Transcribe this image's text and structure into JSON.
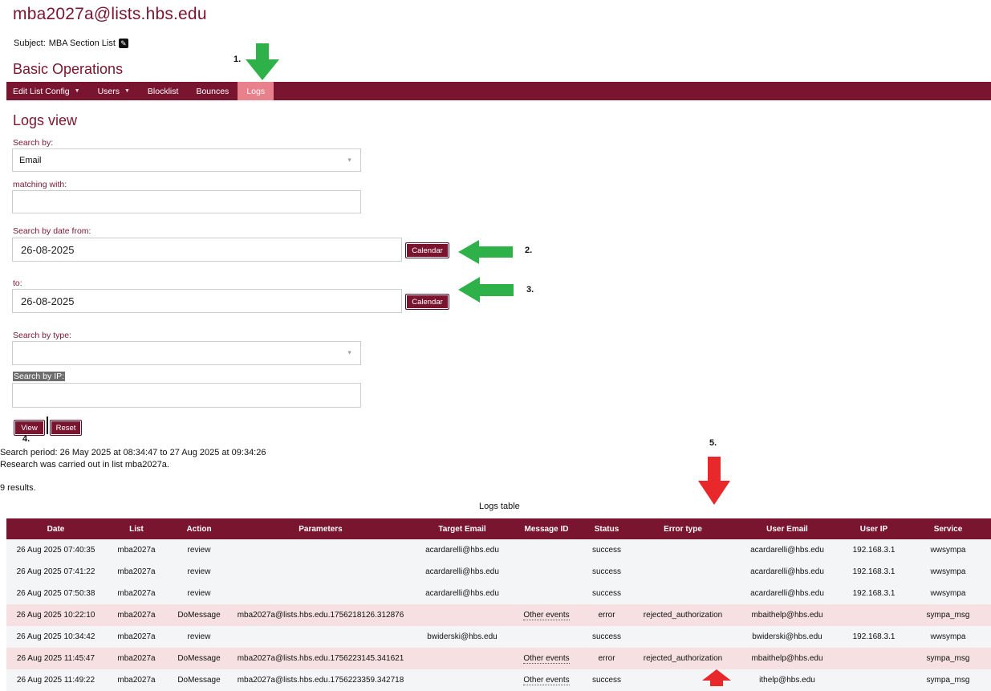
{
  "header": {
    "list_address": "mba2027a@lists.hbs.edu",
    "subject_label": "Subject:",
    "subject_value": "MBA Section List",
    "edit_icon": "pencil-square-icon",
    "section_title": "Basic Operations"
  },
  "menu": {
    "items": [
      {
        "label": "Edit List Config",
        "has_dropdown": true
      },
      {
        "label": "Users",
        "has_dropdown": true
      },
      {
        "label": "Blocklist",
        "has_dropdown": false
      },
      {
        "label": "Bounces",
        "has_dropdown": false
      },
      {
        "label": "Logs",
        "has_dropdown": false,
        "active": true
      }
    ]
  },
  "form": {
    "title": "Logs view",
    "search_by_label": "Search by:",
    "search_by_value": "Email",
    "matching_label": "matching with:",
    "matching_value": "",
    "date_from_label": "Search by date from:",
    "date_from_value": "26-08-2025",
    "date_to_label": "to:",
    "date_to_value": "26-08-2025",
    "calendar_label": "Calendar",
    "type_label": "Search by type:",
    "type_value": "",
    "ip_label": "Search by IP:",
    "ip_value": "",
    "view_label": "View",
    "reset_label": "Reset"
  },
  "annotations": {
    "a1": "1.",
    "a2": "2.",
    "a3": "3.",
    "a4": "4.",
    "a5": "5."
  },
  "results": {
    "period_line": "Search period: 26 May 2025 at 08:34:47 to 27 Aug 2025 at 09:34:26",
    "list_line": "Research was carried out in list mba2027a.",
    "results_line": "9 results.",
    "table_caption": "Logs table"
  },
  "table": {
    "headers": [
      "Date",
      "List",
      "Action",
      "Parameters",
      "Target Email",
      "Message ID",
      "Status",
      "Error type",
      "User Email",
      "User IP",
      "Service"
    ],
    "rows": [
      {
        "kind": "normal",
        "cells": [
          "26 Aug 2025 07:40:35",
          "mba2027a",
          "review",
          "",
          "acardarelli@hbs.edu",
          "",
          "success",
          "",
          "acardarelli@hbs.edu",
          "192.168.3.1",
          "wwsympa"
        ]
      },
      {
        "kind": "normal",
        "cells": [
          "26 Aug 2025 07:41:22",
          "mba2027a",
          "review",
          "",
          "acardarelli@hbs.edu",
          "",
          "success",
          "",
          "acardarelli@hbs.edu",
          "192.168.3.1",
          "wwsympa"
        ]
      },
      {
        "kind": "normal",
        "cells": [
          "26 Aug 2025 07:50:38",
          "mba2027a",
          "review",
          "",
          "acardarelli@hbs.edu",
          "",
          "success",
          "",
          "acardarelli@hbs.edu",
          "192.168.3.1",
          "wwsympa"
        ]
      },
      {
        "kind": "error",
        "cells": [
          "26 Aug 2025 10:22:10",
          "mba2027a",
          "DoMessage",
          "mba2027a@lists.hbs.edu.1756218126.312876",
          "",
          "Other events",
          "error",
          "rejected_authorization",
          "mbaithelp@hbs.edu",
          "",
          "sympa_msg"
        ]
      },
      {
        "kind": "normal",
        "cells": [
          "26 Aug 2025 10:34:42",
          "mba2027a",
          "review",
          "",
          "bwiderski@hbs.edu",
          "",
          "success",
          "",
          "bwiderski@hbs.edu",
          "192.168.3.1",
          "wwsympa"
        ]
      },
      {
        "kind": "error",
        "cells": [
          "26 Aug 2025 11:45:47",
          "mba2027a",
          "DoMessage",
          "mba2027a@lists.hbs.edu.1756223145.341621",
          "",
          "Other events",
          "error",
          "rejected_authorization",
          "mbaithelp@hbs.edu",
          "",
          "sympa_msg"
        ]
      },
      {
        "kind": "bottom",
        "cells": [
          "26 Aug 2025 11:49:22",
          "mba2027a",
          "DoMessage",
          "mba2027a@lists.hbs.edu.1756223359.342718",
          "",
          "Other events",
          "success",
          "",
          "ithelp@hbs.edu",
          "",
          "sympa_msg"
        ]
      }
    ]
  },
  "colors": {
    "brand": "#7a1530",
    "active_tab": "#e8818b",
    "green_arrow": "#2fb14a",
    "red_arrow": "#e8282b",
    "error_row": "#f6e0e1",
    "normal_row": "#f3f5f7"
  }
}
